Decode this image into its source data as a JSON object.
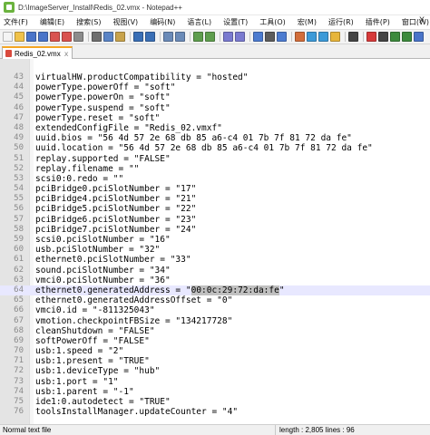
{
  "window": {
    "title": "D:\\ImageServer_Install\\Redis_02.vmx - Notepad++"
  },
  "menu": {
    "items": [
      "文件(F)",
      "编辑(E)",
      "搜索(S)",
      "视图(V)",
      "编码(N)",
      "语言(L)",
      "设置(T)",
      "工具(O)",
      "宏(M)",
      "运行(R)",
      "插件(P)",
      "窗口(W)",
      "?"
    ],
    "close": "X"
  },
  "toolbar": {
    "buttons": [
      {
        "icon": "new-file-icon",
        "color": "#f4f4f4"
      },
      {
        "icon": "open-file-icon",
        "color": "#f0c24a"
      },
      {
        "icon": "save-icon",
        "color": "#4a74c9"
      },
      {
        "icon": "save-all-icon",
        "color": "#4a74c9"
      },
      {
        "icon": "close-file-icon",
        "color": "#d9534f"
      },
      {
        "icon": "close-all-icon",
        "color": "#d9534f"
      },
      {
        "icon": "print-icon",
        "color": "#8c8c8c"
      },
      {
        "sep": true
      },
      {
        "icon": "cut-icon",
        "color": "#6f6f6f"
      },
      {
        "icon": "copy-icon",
        "color": "#5a84c6"
      },
      {
        "icon": "paste-icon",
        "color": "#c8a34c"
      },
      {
        "sep": true
      },
      {
        "icon": "undo-icon",
        "color": "#3a6fb6"
      },
      {
        "icon": "redo-icon",
        "color": "#3a6fb6"
      },
      {
        "sep": true
      },
      {
        "icon": "find-icon",
        "color": "#6b8bb8"
      },
      {
        "icon": "replace-icon",
        "color": "#6b8bb8"
      },
      {
        "sep": true
      },
      {
        "icon": "zoom-in-icon",
        "color": "#5f9e4e"
      },
      {
        "icon": "zoom-out-icon",
        "color": "#5f9e4e"
      },
      {
        "sep": true
      },
      {
        "icon": "sync-vertical-icon",
        "color": "#7a7ad0"
      },
      {
        "icon": "sync-horizontal-icon",
        "color": "#7a7ad0"
      },
      {
        "sep": true
      },
      {
        "icon": "word-wrap-icon",
        "color": "#4c7bd0"
      },
      {
        "icon": "show-all-chars-icon",
        "color": "#5c5c5c"
      },
      {
        "icon": "indent-guide-icon",
        "color": "#4c7bd0"
      },
      {
        "sep": true
      },
      {
        "icon": "define-language-icon",
        "color": "#d26d3a"
      },
      {
        "icon": "doc-map-icon",
        "color": "#3c9ad8"
      },
      {
        "icon": "function-list-icon",
        "color": "#3c9ad8"
      },
      {
        "icon": "folder-workspace-icon",
        "color": "#e7b53b"
      },
      {
        "sep": true
      },
      {
        "icon": "monitoring-icon",
        "color": "#444444"
      },
      {
        "sep": true
      },
      {
        "icon": "record-macro-icon",
        "color": "#d63a3a"
      },
      {
        "icon": "stop-record-icon",
        "color": "#444444"
      },
      {
        "icon": "play-macro-icon",
        "color": "#3d8a3d"
      },
      {
        "icon": "play-multiple-icon",
        "color": "#3d8a3d"
      },
      {
        "icon": "save-macro-icon",
        "color": "#4a74c9"
      }
    ]
  },
  "tab": {
    "label": "Redis_02.vmx",
    "close": "x"
  },
  "editor": {
    "current_line": 64,
    "highlight": "00:0c:29:72:da:fe",
    "lines": [
      {
        "n": "43",
        "text": "virtualHW.productCompatibility = \"hosted\""
      },
      {
        "n": "44",
        "text": "powerType.powerOff = \"soft\""
      },
      {
        "n": "45",
        "text": "powerType.powerOn = \"soft\""
      },
      {
        "n": "46",
        "text": "powerType.suspend = \"soft\""
      },
      {
        "n": "47",
        "text": "powerType.reset = \"soft\""
      },
      {
        "n": "48",
        "text": "extendedConfigFile = \"Redis_02.vmxf\""
      },
      {
        "n": "49",
        "text": "uuid.bios = \"56 4d 57 2e 68 db 85 a6-c4 01 7b 7f 81 72 da fe\""
      },
      {
        "n": "50",
        "text": "uuid.location = \"56 4d 57 2e 68 db 85 a6-c4 01 7b 7f 81 72 da fe\""
      },
      {
        "n": "51",
        "text": "replay.supported = \"FALSE\""
      },
      {
        "n": "52",
        "text": "replay.filename = \"\""
      },
      {
        "n": "53",
        "text": "scsi0:0.redo = \"\""
      },
      {
        "n": "54",
        "text": "pciBridge0.pciSlotNumber = \"17\""
      },
      {
        "n": "55",
        "text": "pciBridge4.pciSlotNumber = \"21\""
      },
      {
        "n": "56",
        "text": "pciBridge5.pciSlotNumber = \"22\""
      },
      {
        "n": "57",
        "text": "pciBridge6.pciSlotNumber = \"23\""
      },
      {
        "n": "58",
        "text": "pciBridge7.pciSlotNumber = \"24\""
      },
      {
        "n": "59",
        "text": "scsi0.pciSlotNumber = \"16\""
      },
      {
        "n": "60",
        "text": "usb.pciSlotNumber = \"32\""
      },
      {
        "n": "61",
        "text": "ethernet0.pciSlotNumber = \"33\""
      },
      {
        "n": "62",
        "text": "sound.pciSlotNumber = \"34\""
      },
      {
        "n": "63",
        "text": "vmci0.pciSlotNumber = \"36\""
      },
      {
        "n": "64",
        "prefix": "ethernet0.generatedAddress = \"",
        "hl": "00:0c:29:72:da:fe",
        "suffix": "\""
      },
      {
        "n": "65",
        "text": "ethernet0.generatedAddressOffset = \"0\""
      },
      {
        "n": "66",
        "text": "vmci0.id = \"-811325043\""
      },
      {
        "n": "67",
        "text": "vmotion.checkpointFBSize = \"134217728\""
      },
      {
        "n": "68",
        "text": "cleanShutdown = \"FALSE\""
      },
      {
        "n": "69",
        "text": "softPowerOff = \"FALSE\""
      },
      {
        "n": "70",
        "text": "usb:1.speed = \"2\""
      },
      {
        "n": "71",
        "text": "usb:1.present = \"TRUE\""
      },
      {
        "n": "72",
        "text": "usb:1.deviceType = \"hub\""
      },
      {
        "n": "73",
        "text": "usb:1.port = \"1\""
      },
      {
        "n": "74",
        "text": "usb:1.parent = \"-1\""
      },
      {
        "n": "75",
        "text": "ide1:0.autodetect = \"TRUE\""
      },
      {
        "n": "76",
        "text": "toolsInstallManager.updateCounter = \"4\""
      }
    ]
  },
  "status": {
    "doc_type": "Normal text file",
    "position": "length : 2,805    lines : 96"
  }
}
